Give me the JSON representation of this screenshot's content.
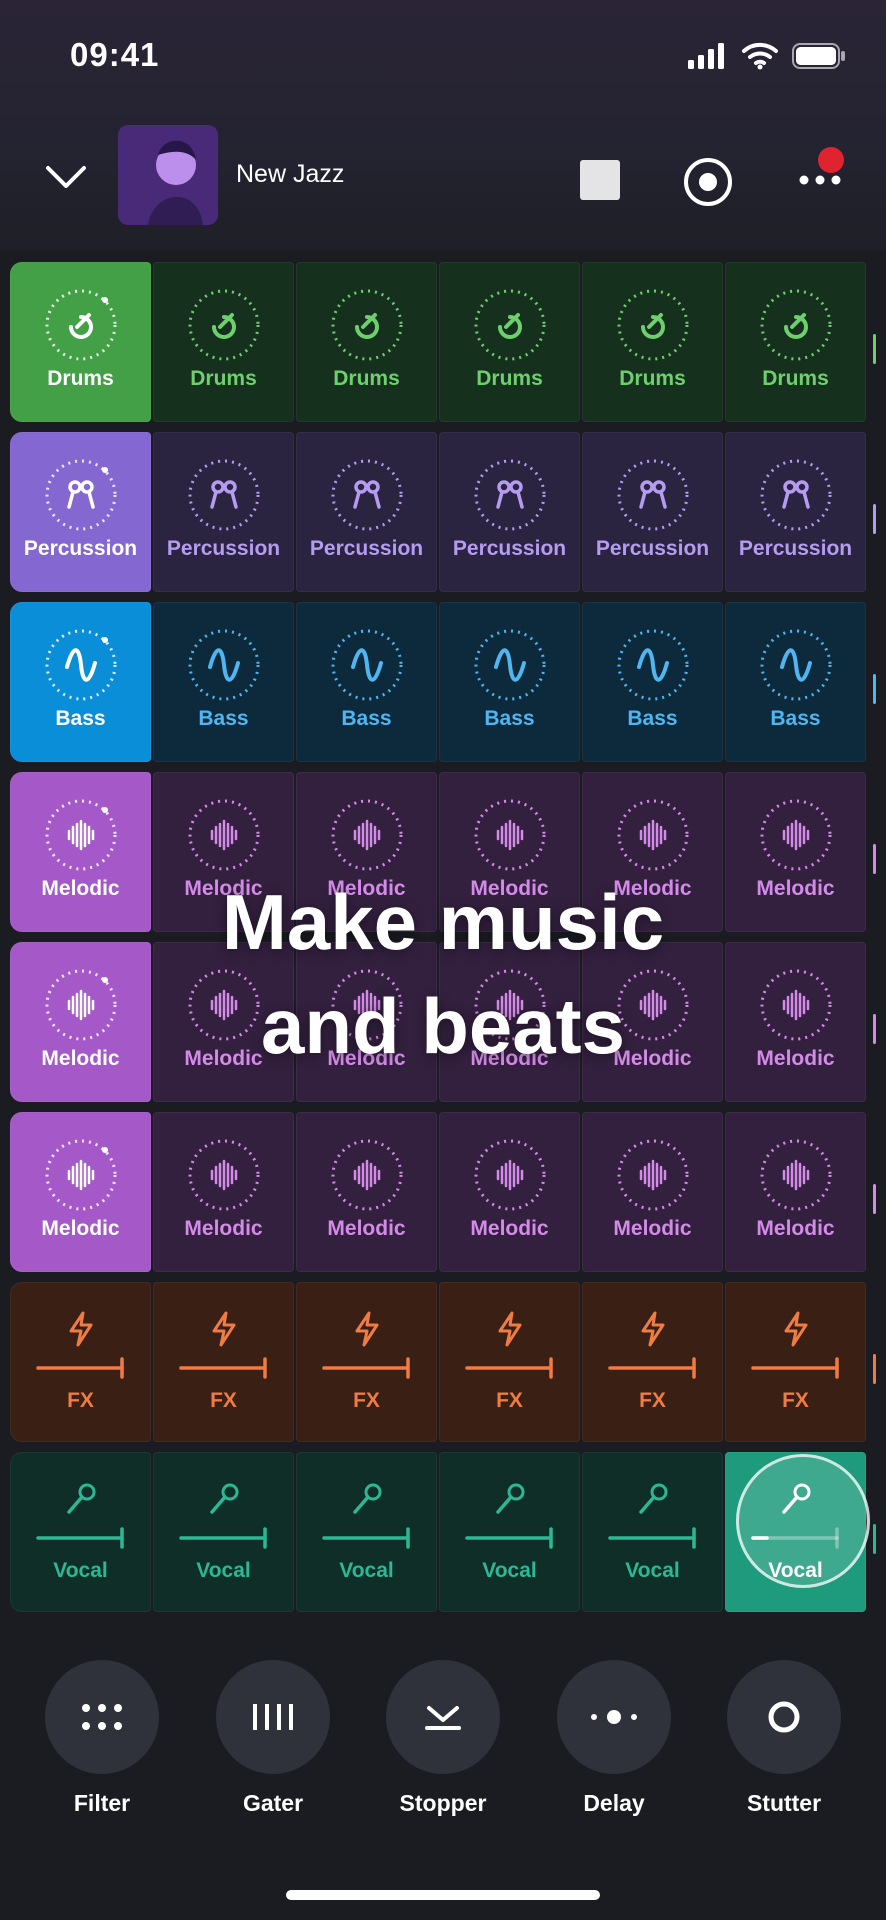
{
  "status_bar": {
    "time": "09:41"
  },
  "header": {
    "title": "New Jazz"
  },
  "rows": [
    {
      "label": "Drums",
      "kind": "drums"
    },
    {
      "label": "Percussion",
      "kind": "percussion"
    },
    {
      "label": "Bass",
      "kind": "bass"
    },
    {
      "label": "Melodic",
      "kind": "melodic"
    },
    {
      "label": "Melodic",
      "kind": "melodic"
    },
    {
      "label": "Melodic",
      "kind": "melodic"
    },
    {
      "label": "FX",
      "kind": "fx"
    },
    {
      "label": "Vocal",
      "kind": "vocal"
    }
  ],
  "overlay": {
    "line1": "Make music",
    "line2": "and beats"
  },
  "effects": [
    {
      "label": "Filter",
      "icon": "dots-grid-icon"
    },
    {
      "label": "Gater",
      "icon": "bars-icon"
    },
    {
      "label": "Stopper",
      "icon": "stopper-arrow-icon"
    },
    {
      "label": "Delay",
      "icon": "delay-dots-icon"
    },
    {
      "label": "Stutter",
      "icon": "ring-icon"
    }
  ],
  "colors": {
    "drums_active": "#43a047",
    "drums_dim": "#16301e",
    "drums_accent": "#6fcf6f",
    "perc_active": "#8467d0",
    "perc_dim": "#2a2440",
    "perc_accent": "#b59cf0",
    "bass_active": "#0b8ed8",
    "bass_dim": "#0d2a3c",
    "bass_accent": "#4fb6f0",
    "melodic_active": "#a559c8",
    "melodic_dim": "#33203f",
    "melodic_accent": "#d48be8",
    "fx_dim": "#3a1f14",
    "fx_accent": "#ef7b45",
    "vocal_dim": "#0f2e28",
    "vocal_accent": "#2bb894",
    "vocal_active": "#1e9a7c"
  }
}
